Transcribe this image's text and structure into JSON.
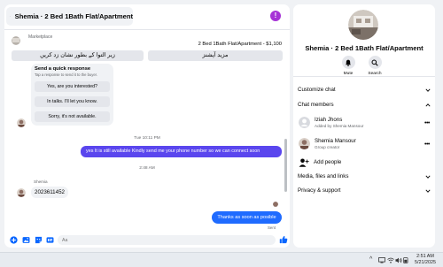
{
  "colors": {
    "brand_purple": "#a633d6",
    "outgoing_purple": "#5a46ee",
    "outgoing_blue": "#1f6bff",
    "messenger_blue": "#0866ff",
    "bubble_gray": "#f0f2f5",
    "button_gray": "#e4e6eb",
    "secondary_text": "#65676b"
  },
  "chat": {
    "contact_name": "Shemia · 2 Bed 1Bath Flat/Apartment",
    "info_icon": "info-icon",
    "info_symbol": "!",
    "marketplace_label": "Marketplace",
    "listing_title": "2 Bed 1Bath Flat/Apartment - $1,100",
    "listing_buttons": [
      "زیر التوا کے بطور نشان زد کریں",
      "مزید آپشنز"
    ],
    "quick_response": {
      "title": "Send a quick response",
      "subtitle": "Tap a response to send it to the buyer.",
      "options": [
        "Yes, are you interested?",
        "In talks. I'll let you know.",
        "Sorry, it's not available."
      ]
    },
    "timestamp_1": "Tue 10:11 PM",
    "outgoing_1": "yes It is still available Kindly send me your phone number so we can connect soon",
    "timestamp_2": "2:48 AM",
    "sender_name": "Shemia",
    "incoming_1": "2023611452",
    "outgoing_2": "Thanks as soon as posible",
    "sent_status": "Sent",
    "composer": {
      "placeholder": "Aa",
      "icons": [
        "plus-circle-icon",
        "photo-icon",
        "sticker-icon",
        "gif-icon",
        "thumbs-up-icon"
      ]
    }
  },
  "info": {
    "profile_name": "Shemia · 2 Bed 1Bath Flat/Apartment",
    "actions": [
      {
        "label": "Mute",
        "icon": "bell-icon"
      },
      {
        "label": "Search",
        "icon": "search-icon"
      }
    ],
    "sections": {
      "customize": "Customize chat",
      "members": "Chat members",
      "media": "Media, files and links",
      "privacy": "Privacy & support"
    },
    "members": [
      {
        "name": "Iziah Jhons",
        "role": "Added by Shemia Mansour"
      },
      {
        "name": "Shemia Mansour",
        "role": "Group creator"
      }
    ],
    "more_symbol": "•••",
    "add_people": "Add people"
  },
  "taskbar": {
    "time": "2:51 AM",
    "date": "5/21/2025",
    "chevron": "^",
    "icons": [
      "tray-chevron-icon",
      "display-icon",
      "wifi-icon",
      "volume-icon",
      "battery-icon"
    ]
  }
}
